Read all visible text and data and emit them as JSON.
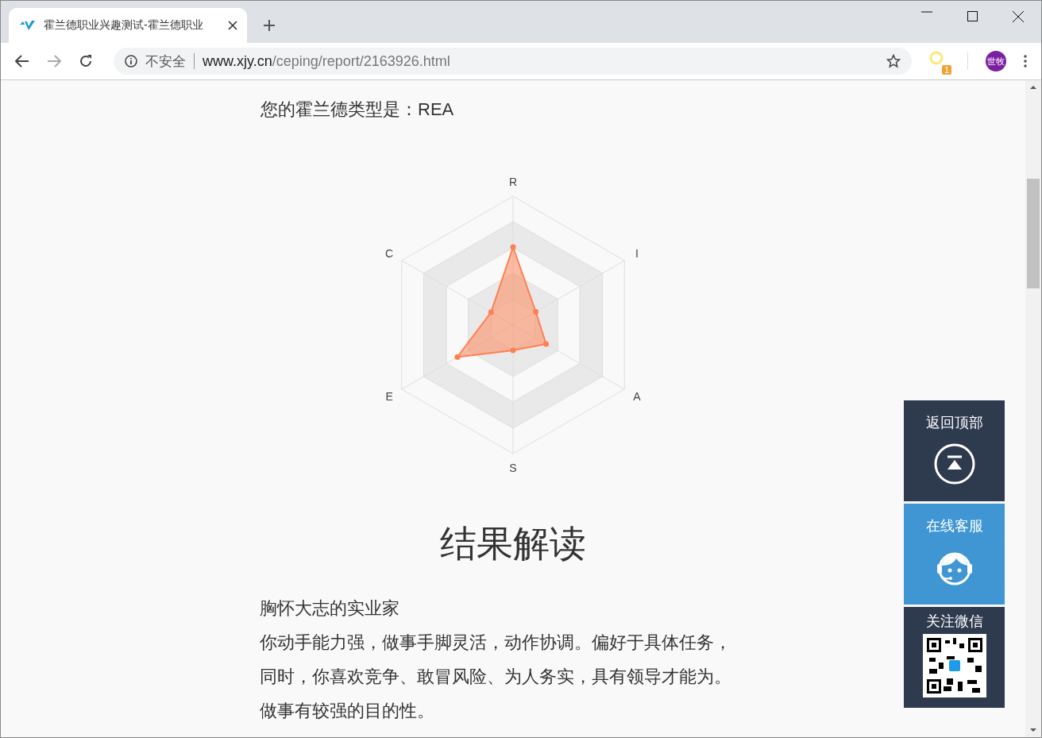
{
  "browser": {
    "tab": {
      "title": "霍兰德职业兴趣测试-霍兰德职业",
      "selected": true
    },
    "security_label": "不安全",
    "url_host": "www.xjy.cn",
    "url_path": "/ceping/report/2163926.html",
    "extension_badge": "1",
    "profile": "世牧"
  },
  "page": {
    "type_heading": "您的霍兰德类型是：REA",
    "radar": {
      "axes": [
        "R",
        "I",
        "A",
        "S",
        "E",
        "C"
      ]
    },
    "section_title": "结果解读",
    "result_title": "胸怀大志的实业家",
    "result_lines": [
      "你动手能力强，做事手脚灵活，动作协调。偏好于具体任务，",
      "同时，你喜欢竞争、敢冒风险、为人务实，具有领导才能为。",
      "做事有较强的目的性。"
    ]
  },
  "side_panel": [
    {
      "kind": "top",
      "label": "返回顶部"
    },
    {
      "kind": "service",
      "label": "在线客服"
    },
    {
      "kind": "wechat",
      "label": "关注微信"
    }
  ]
}
